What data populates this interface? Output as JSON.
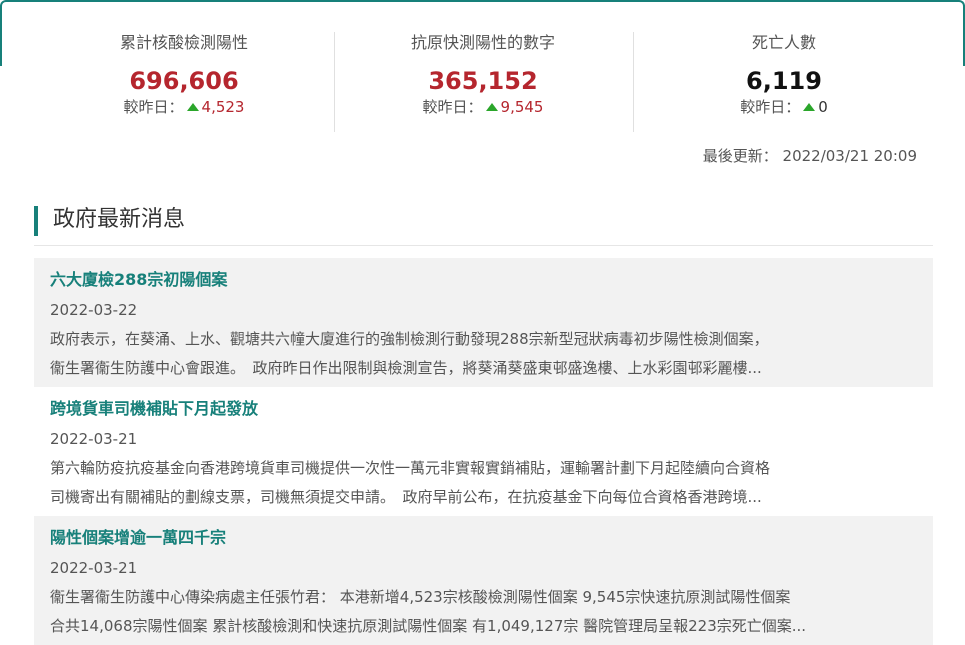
{
  "stats": [
    {
      "label": "累計核酸檢測陽性",
      "value": "696,606",
      "change_label": "較昨日：",
      "change": "4,523",
      "value_color": "#b5262e",
      "change_color": "#b5262e"
    },
    {
      "label": "抗原快測陽性的數字",
      "value": "365,152",
      "change_label": "較昨日：",
      "change": "9,545",
      "value_color": "#b5262e",
      "change_color": "#b5262e"
    },
    {
      "label": "死亡人數",
      "value": "6,119",
      "change_label": "較昨日：",
      "change": "0",
      "value_color": "#111111",
      "change_color": "#333333"
    }
  ],
  "last_updated": "最後更新： 2022/03/21 20:09",
  "section_title": "政府最新消息",
  "news": [
    {
      "title": "六大廈檢288宗初陽個案",
      "date": "2022-03-22",
      "line1": "政府表示，在葵涌、上水、觀塘共六幢大廈進行的強制檢測行動發現288宗新型冠狀病毒初步陽性檢測個案，",
      "line2": "衞生署衞生防護中心會跟進。　政府昨日作出限制與檢測宣告，將葵涌葵盛東邨盛逸樓、上水彩園邨彩麗樓..."
    },
    {
      "title": "跨境貨車司機補貼下月起發放",
      "date": "2022-03-21",
      "line1": "第六輪防疫抗疫基金向香港跨境貨車司機提供一次性一萬元非實報實銷補貼，運輸署計劃下月起陸續向合資格",
      "line2": "司機寄出有關補貼的劃線支票，司機無須提交申請。　政府早前公布，在抗疫基金下向每位合資格香港跨境..."
    },
    {
      "title": "陽性個案增逾一萬四千宗",
      "date": "2022-03-21",
      "line1": "衞生署衞生防護中心傳染病處主任張竹君： 本港新增4,523宗核酸檢測陽性個案 9,545宗快速抗原測試陽性個案",
      "line2": "合共14,068宗陽性個案 累計核酸檢測和快速抗原測試陽性個案 有1,049,127宗 醫院管理局呈報223宗死亡個案..."
    }
  ]
}
